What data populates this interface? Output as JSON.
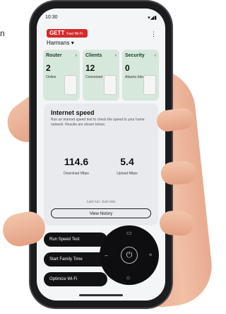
{
  "page_edge_text": "n",
  "status_bar": {
    "time": "10:30",
    "icons": "▾◢▮"
  },
  "header": {
    "logo_text": "GETT",
    "logo_sub": "Fast Wi-Fi",
    "network_name": "Harmans",
    "menu_glyph": "⋮"
  },
  "cards": [
    {
      "title": "Router",
      "value": "2",
      "sub": "Online"
    },
    {
      "title": "Clients",
      "value": "12",
      "sub": "Connected"
    },
    {
      "title": "Security",
      "value": "0",
      "sub": "Attacks blocked"
    }
  ],
  "speed": {
    "heading": "Internet speed",
    "description": "Run an internet speed test to check the speed to your home network. Results are shown below.",
    "download_value": "114.6",
    "download_label": "Download Mbps",
    "upload_value": "5.4",
    "upload_label": "Upload Mbps",
    "last_run": "Last run: Just now",
    "history_button": "View history"
  },
  "actions": [
    "Run Speed Test",
    "Start Family Time",
    "Optimize Wi-Fi"
  ],
  "wheel": {
    "center_icon": "power-icon",
    "top": "▭",
    "left": "←",
    "right": "≈",
    "bottom": "⌂"
  }
}
